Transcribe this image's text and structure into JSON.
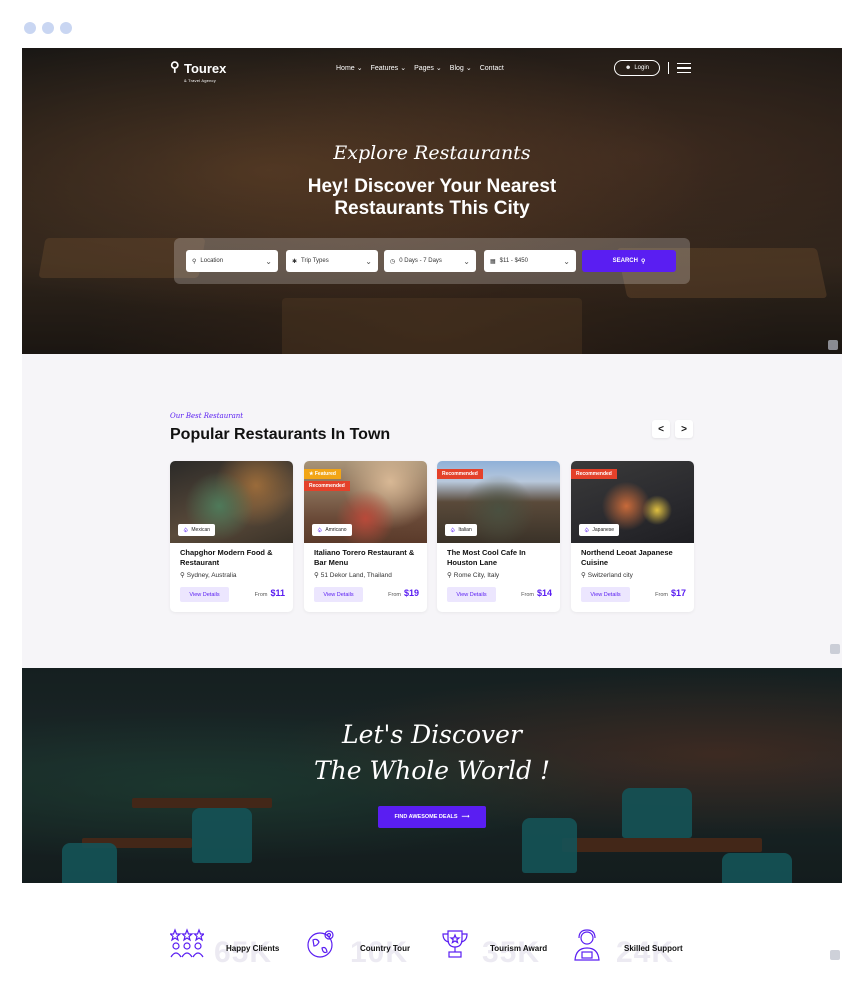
{
  "window": {
    "dots": 3
  },
  "nav": {
    "logo_name": "Tourex",
    "logo_sub": "& Travel Agency",
    "menu": [
      "Home",
      "Features",
      "Pages",
      "Blog",
      "Contact"
    ],
    "menu_dropdown": [
      true,
      true,
      true,
      true,
      false
    ],
    "login": "Login"
  },
  "hero": {
    "script": "Explore Restaurants",
    "title_line1": "Hey! Discover Your Nearest",
    "title_line2": "Restaurants This City",
    "search": {
      "location": "Location",
      "trip_types": "Trip Types",
      "days": "0 Days - 7 Days",
      "price": "$11 - $450",
      "button": "SEARCH"
    }
  },
  "popular": {
    "eyebrow": "Our Best Restaurant",
    "title": "Popular Restaurants In Town",
    "prev": "<",
    "next": ">",
    "cards": [
      {
        "badges": [],
        "cuisine": "Mexican",
        "name": "Chapghor Modern Food & Restaurant",
        "location": "Sydney, Australia",
        "button": "View Details",
        "from": "From",
        "price": "$11"
      },
      {
        "badges": [
          "Featured",
          "Recommended"
        ],
        "cuisine": "Amricano",
        "name": "Italiano Torero Restaurant & Bar Menu",
        "location": "51 Dekor Land, Thailand",
        "button": "View Details",
        "from": "From",
        "price": "$19"
      },
      {
        "badges": [
          "Recommended"
        ],
        "cuisine": "Italian",
        "name": "The Most Cool Cafe In Houston Lane",
        "location": "Rome City, Italy",
        "button": "View Details",
        "from": "From",
        "price": "$14"
      },
      {
        "badges": [
          "Recommended"
        ],
        "cuisine": "Japanese",
        "name": "Northend Leoat Japanese Cuisine",
        "location": "Switzerland city",
        "button": "View Details",
        "from": "From",
        "price": "$17"
      }
    ]
  },
  "cta": {
    "line1": "Let's Discover",
    "line2": "The Whole World !",
    "button": "FIND AWESOME DEALS"
  },
  "stats": [
    {
      "icon": "stars-group-icon",
      "number": "65K",
      "label": "Happy Clients"
    },
    {
      "icon": "globe-map-icon",
      "number": "10K",
      "label": "Country Tour"
    },
    {
      "icon": "trophy-icon",
      "number": "35K",
      "label": "Tourism Award"
    },
    {
      "icon": "support-agent-icon",
      "number": "24K",
      "label": "Skilled Support"
    }
  ],
  "colors": {
    "accent": "#5a1ef2",
    "recommended": "#e4412a",
    "featured": "#f2a516",
    "section_bg": "#f6f5f8"
  }
}
